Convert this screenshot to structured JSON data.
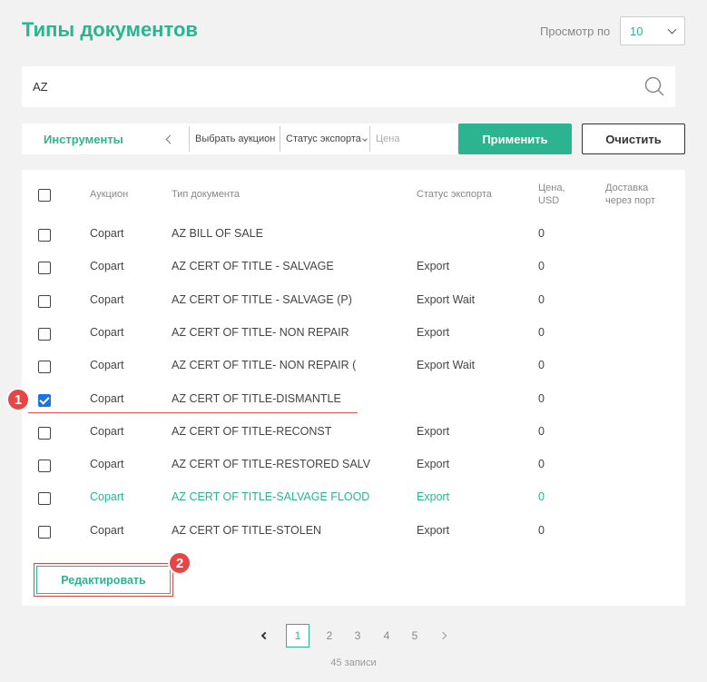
{
  "header": {
    "title": "Типы документов",
    "view_label": "Просмотр по",
    "view_value": "10"
  },
  "search": {
    "value": "AZ",
    "placeholder": ""
  },
  "toolbar": {
    "tools_label": "Инструменты",
    "auction_label": "Выбрать аукцион",
    "status_label": "Статус экспорта",
    "price_placeholder": "Цена",
    "apply_label": "Применить",
    "clear_label": "Очистить"
  },
  "table": {
    "headers": {
      "auction": "Аукцион",
      "doc_type": "Тип документа",
      "export_status": "Статус экспорта",
      "price": "Цена, USD",
      "delivery": "Доставка через порт"
    },
    "rows": [
      {
        "auction": "Copart",
        "doc_type": "AZ BILL OF SALE",
        "status": "",
        "price": "0",
        "checked": false,
        "highlight": false
      },
      {
        "auction": "Copart",
        "doc_type": "AZ CERT OF TITLE - SALVAGE",
        "status": "Export",
        "price": "0",
        "checked": false,
        "highlight": false
      },
      {
        "auction": "Copart",
        "doc_type": "AZ CERT OF TITLE - SALVAGE (P)",
        "status": "Export Wait",
        "price": "0",
        "checked": false,
        "highlight": false
      },
      {
        "auction": "Copart",
        "doc_type": "AZ CERT OF TITLE- NON REPAIR",
        "status": "Export",
        "price": "0",
        "checked": false,
        "highlight": false
      },
      {
        "auction": "Copart",
        "doc_type": "AZ CERT OF TITLE- NON REPAIR (",
        "status": "Export Wait",
        "price": "0",
        "checked": false,
        "highlight": false
      },
      {
        "auction": "Copart",
        "doc_type": "AZ CERT OF TITLE-DISMANTLE",
        "status": "",
        "price": "0",
        "checked": true,
        "highlight": false
      },
      {
        "auction": "Copart",
        "doc_type": "AZ CERT OF TITLE-RECONST",
        "status": "Export",
        "price": "0",
        "checked": false,
        "highlight": false
      },
      {
        "auction": "Copart",
        "doc_type": "AZ CERT OF TITLE-RESTORED SALV",
        "status": "Export",
        "price": "0",
        "checked": false,
        "highlight": false
      },
      {
        "auction": "Copart",
        "doc_type": "AZ CERT OF TITLE-SALVAGE FLOOD",
        "status": "Export",
        "price": "0",
        "checked": false,
        "highlight": true
      },
      {
        "auction": "Copart",
        "doc_type": "AZ CERT OF TITLE-STOLEN",
        "status": "Export",
        "price": "0",
        "checked": false,
        "highlight": false
      }
    ]
  },
  "edit_label": "Редактировать",
  "markers": {
    "one": "1",
    "two": "2"
  },
  "pagination": {
    "pages": [
      "1",
      "2",
      "3",
      "4",
      "5"
    ],
    "active": "1",
    "records": "45 записи"
  },
  "colors": {
    "accent": "#2bb48f",
    "checkbox": "#1a73e8",
    "marker": "#e84545"
  }
}
